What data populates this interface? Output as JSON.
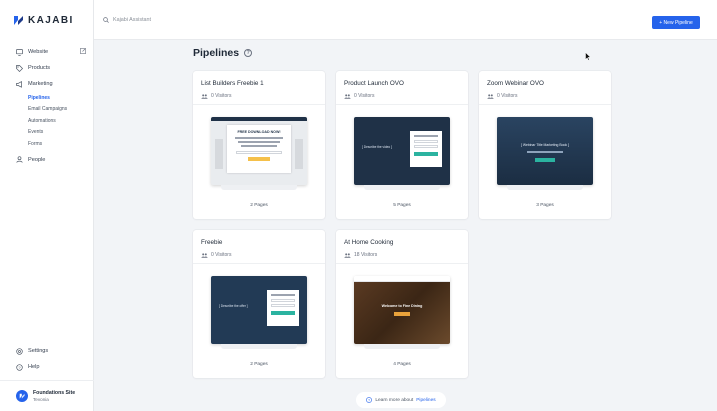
{
  "app": {
    "logo_text": "KAJABI"
  },
  "search": {
    "placeholder": "Kajabi Assistant"
  },
  "topbar": {
    "new_button": "+ New Pipeline"
  },
  "sidebar": {
    "items": [
      {
        "label": "Website",
        "icon": "monitor-icon"
      },
      {
        "label": "Products",
        "icon": "tag-icon"
      },
      {
        "label": "Marketing",
        "icon": "megaphone-icon"
      }
    ],
    "marketing_sub": [
      "Pipelines",
      "Email Campaigns",
      "Automations",
      "Events",
      "Forms"
    ],
    "people": {
      "label": "People",
      "icon": "people-icon"
    },
    "bottom": [
      {
        "label": "Settings",
        "icon": "gear-icon"
      },
      {
        "label": "Help",
        "icon": "help-icon"
      }
    ],
    "account": {
      "name": "Foundations Site",
      "sub": "Tevonia"
    }
  },
  "page": {
    "title": "Pipelines",
    "help": "?"
  },
  "cards": [
    {
      "title": "List Builders Freebie 1",
      "visitors": "0 Visitors",
      "pages": "2 Pages",
      "thumb_text": "FREE DOWNLOAD NOW!"
    },
    {
      "title": "Product Launch OVO",
      "visitors": "0 Visitors",
      "pages": "5 Pages",
      "thumb_text": "[ Describe the video ]"
    },
    {
      "title": "Zoom Webinar OVO",
      "visitors": "0 Visitors",
      "pages": "3 Pages",
      "thumb_text": "[ Webinar Title Marketing Book ]"
    },
    {
      "title": "Freebie",
      "visitors": "0 Visitors",
      "pages": "2 Pages",
      "thumb_text": "[ Describe the offer ]"
    },
    {
      "title": "At Home Cooking",
      "visitors": "18 Visitors",
      "pages": "4 Pages",
      "thumb_text": "Welcome to Fine Dining"
    }
  ],
  "learn": {
    "prefix": "Learn more about",
    "link": "Pipelines"
  },
  "colors": {
    "accent": "#2563eb",
    "navy": "#1f3147",
    "background": "#f2f4f7"
  }
}
